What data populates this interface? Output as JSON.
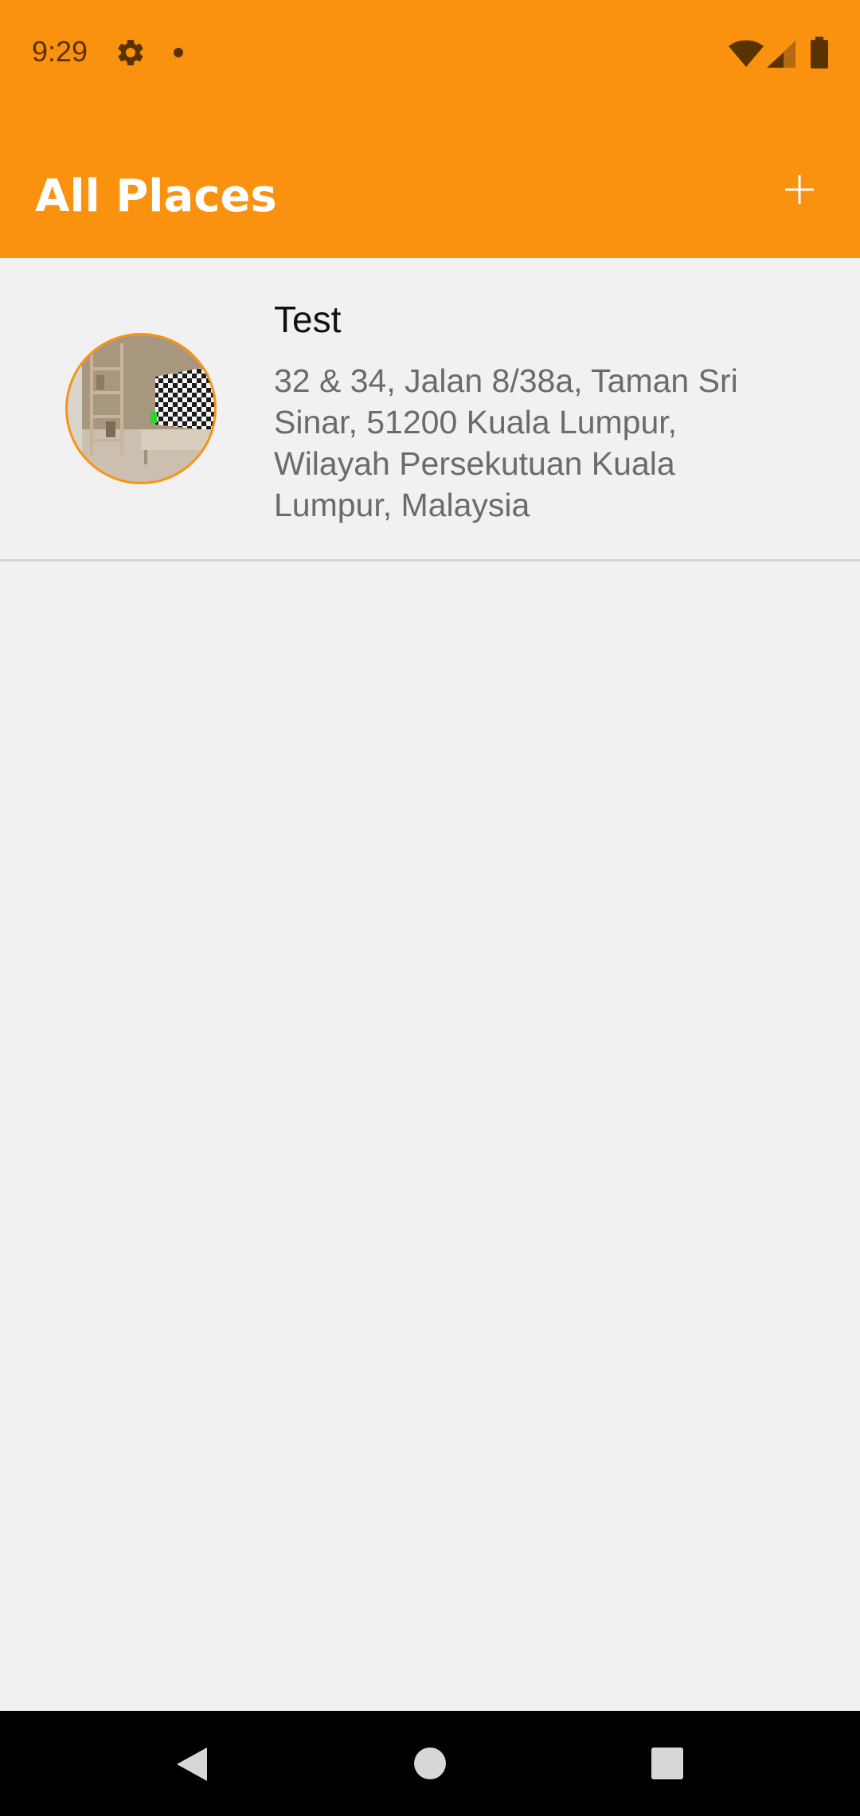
{
  "status_bar": {
    "time": "9:29",
    "icons": [
      "gear-icon",
      "notification-dot-icon",
      "wifi-icon",
      "signal-icon",
      "battery-icon"
    ]
  },
  "app_bar": {
    "title": "All Places",
    "add_icon": "plus-icon"
  },
  "places": [
    {
      "title": "Test",
      "address": "32 & 34, Jalan 8/38a, Taman Sri Sinar, 51200 Kuala Lumpur, Wilayah Persekutuan Kuala Lumpur, Malaysia",
      "thumbnail": "room-photo"
    }
  ],
  "nav_bar": {
    "icons": [
      "back-icon",
      "home-icon",
      "recents-icon"
    ]
  },
  "colors": {
    "primary": "#fb920f",
    "background": "#f1f1f1",
    "title_text": "#ffffff",
    "item_title": "#111111",
    "item_subtitle": "#6b6b6b",
    "thumb_border": "#fb920f"
  }
}
